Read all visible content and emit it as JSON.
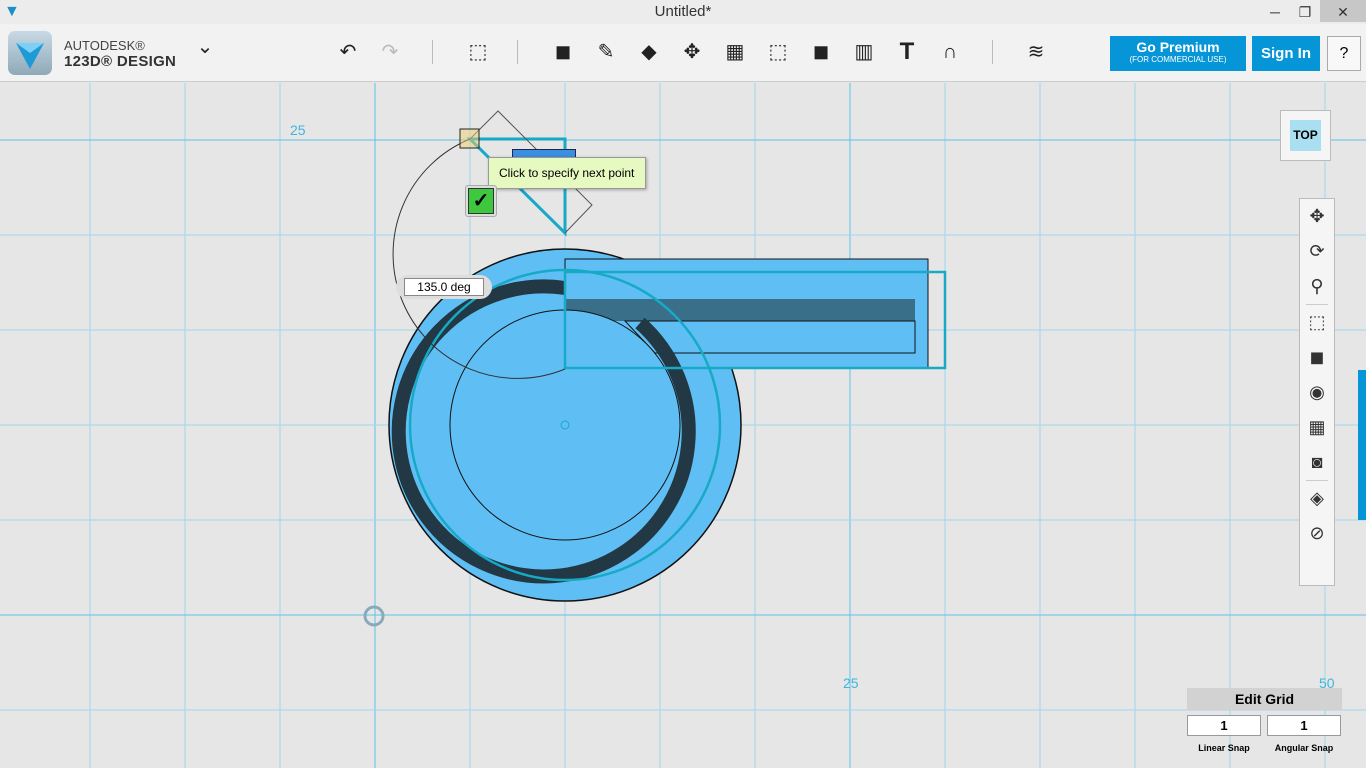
{
  "window": {
    "title": "Untitled*",
    "minimize": "─",
    "restore": "❐",
    "close": "✕"
  },
  "brand": {
    "line1": "AUTODESK®",
    "line2": "123D® DESIGN",
    "menu": "⌄"
  },
  "toolbar": {
    "undo": "↶",
    "redo": "↷",
    "tools": [
      "transform",
      "primitives",
      "sketch",
      "construct",
      "modify",
      "pattern",
      "grouping",
      "combine",
      "measure",
      "text",
      "snap",
      "materials"
    ]
  },
  "premium": {
    "label": "Go Premium",
    "sub": "(FOR COMMERCIAL USE)"
  },
  "sign_in": "Sign In",
  "help": "?",
  "canvas": {
    "axis_labels": {
      "top_left": "25",
      "bottom_mid": "25",
      "bottom_right": "50"
    },
    "tooltip": "Click to specify next point",
    "angle": "135.0 deg",
    "confirm": "✓"
  },
  "viewcube": "TOP",
  "nav": [
    "pan",
    "orbit",
    "zoom",
    "fit",
    "perspective",
    "visibility",
    "grid",
    "snapshot",
    "material",
    "hide"
  ],
  "grid": {
    "title": "Edit Grid",
    "linear_value": "1",
    "angular_value": "1",
    "linear_label": "Linear Snap",
    "angular_label": "Angular Snap"
  },
  "colors": {
    "accent": "#0696d7",
    "shape": "#5fbff5",
    "grid": "#8fd3ea"
  }
}
